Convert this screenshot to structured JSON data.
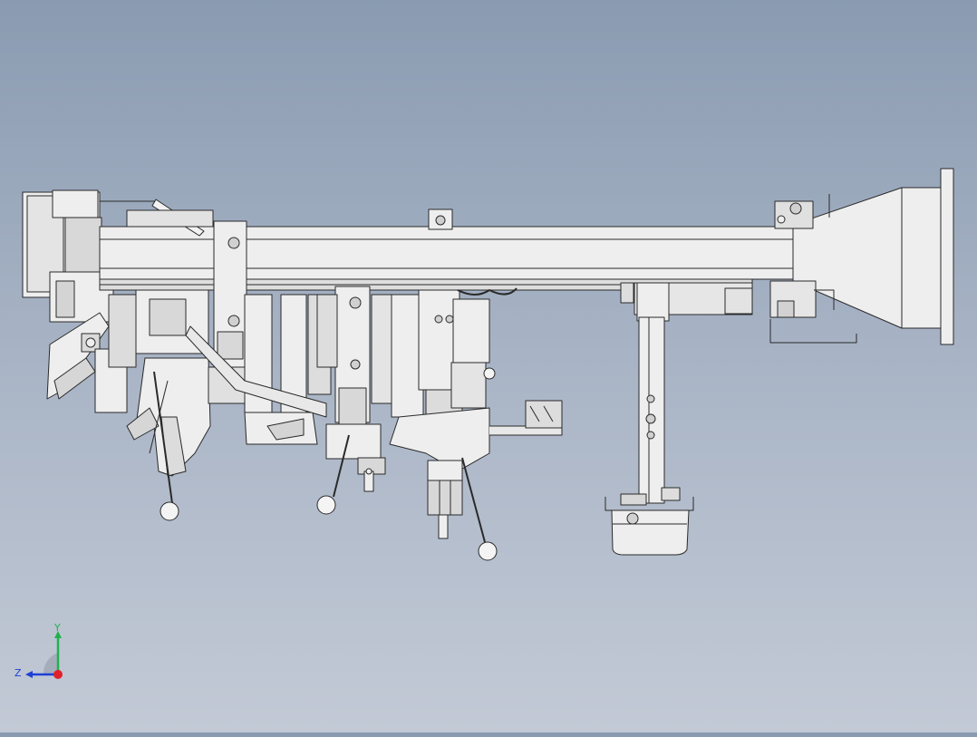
{
  "triad": {
    "y_label": "Y",
    "z_label": "Z",
    "y_color": "#22b14c",
    "z_color": "#1f3fd6",
    "x_color": "#e0202a"
  },
  "model": {
    "line_color": "#2a2a2a",
    "fill_color": "#eeeeee",
    "shade_color": "#cfcfcf"
  }
}
